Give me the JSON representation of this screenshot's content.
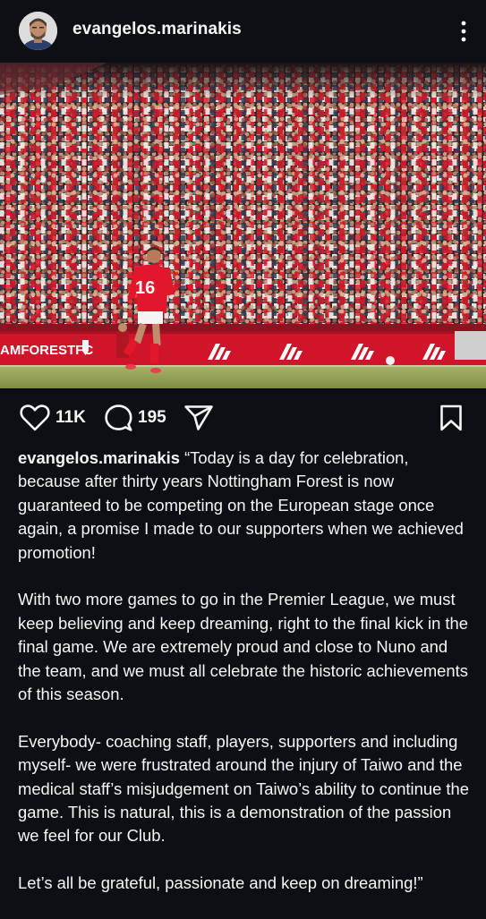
{
  "post": {
    "username": "evangelos.marinakis",
    "likes": "11K",
    "comments": "195"
  },
  "photo": {
    "board_text": "AMFORESTFC",
    "player_number": "16"
  },
  "icons": {
    "more": "more-vertical-icon",
    "like": "heart-icon",
    "comment": "comment-icon",
    "share": "send-icon",
    "save": "bookmark-icon"
  },
  "caption": {
    "username": "evangelos.marinakis",
    "p1": "“Today is a day for celebration, because after thirty years Nottingham Forest is now guaranteed to be competing on the European stage once again, a promise I made to our supporters when we achieved promotion!",
    "p2": "With two more games to go in the Premier League, we must keep believing and keep dreaming, right to the final kick in the final game.  We are extremely proud and close to Nuno and the team, and we must all celebrate the historic achievements of this season.",
    "p3": "Everybody- coaching staff, players, supporters and including myself- we were frustrated around the injury of Taiwo and the medical staff’s misjudgement on Taiwo’s ability to continue the game. This is natural, this is a demonstration of the passion we feel for our Club.",
    "p4": "Let’s all be grateful, passionate and keep on dreaming!”"
  },
  "colors": {
    "background": "#0c1014",
    "text": "#f5f5f5",
    "forest_red": "#d0142a"
  }
}
